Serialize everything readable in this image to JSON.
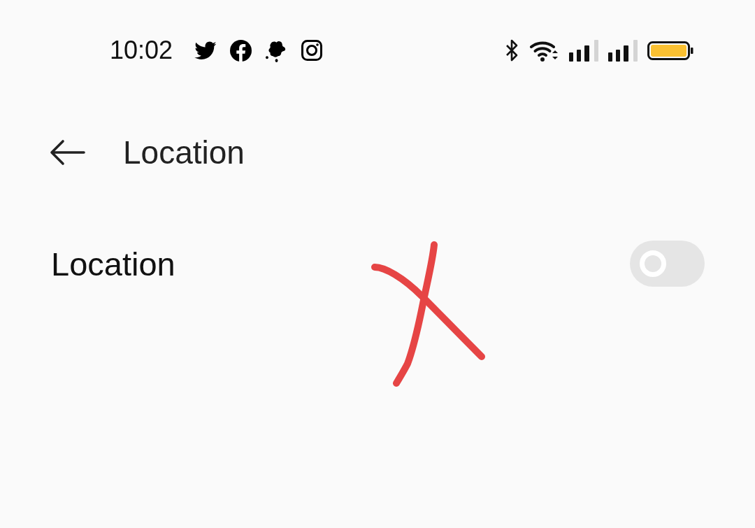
{
  "status_bar": {
    "time": "10:02",
    "notification_icons": [
      {
        "kind": "bird"
      },
      {
        "kind": "f-circle"
      },
      {
        "kind": "splotch"
      },
      {
        "kind": "camera"
      }
    ],
    "system_icons": [
      {
        "kind": "bluetooth"
      },
      {
        "kind": "wifi"
      },
      {
        "kind": "signal"
      },
      {
        "kind": "signal"
      },
      {
        "kind": "battery"
      }
    ]
  },
  "header": {
    "title": "Location"
  },
  "settings": [
    {
      "kind": "toggle",
      "label": "Location",
      "on": false
    }
  ],
  "annotation": {
    "kind": "cross"
  }
}
